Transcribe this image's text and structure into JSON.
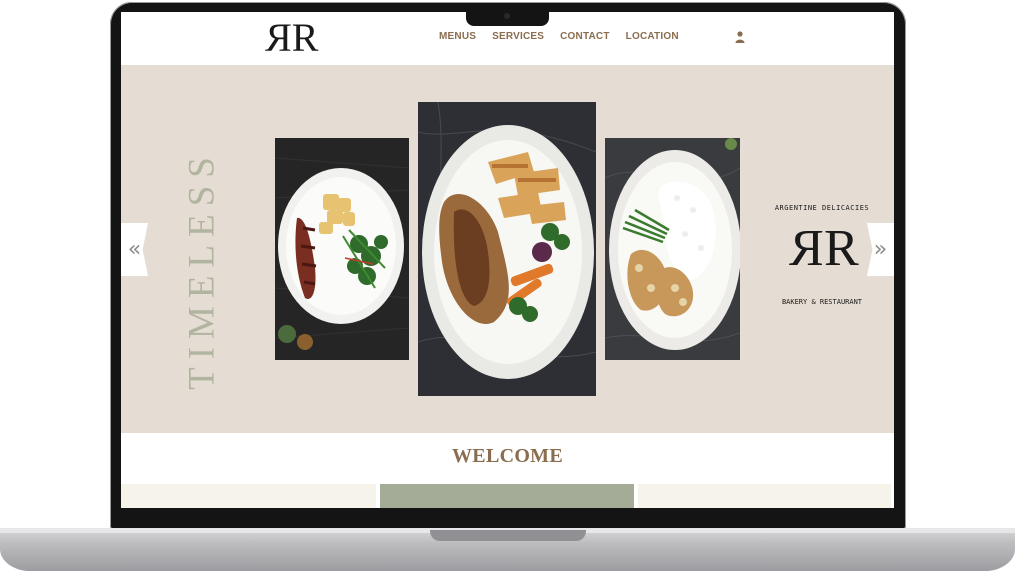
{
  "header": {
    "logo_text_mirror": "R",
    "logo_text": "R",
    "nav": [
      {
        "label": "MENUS"
      },
      {
        "label": "SERVICES"
      },
      {
        "label": "CONTACT"
      },
      {
        "label": "LOCATION"
      }
    ],
    "user_icon": "user-icon"
  },
  "hero": {
    "vertical_title": "TIMELESS",
    "arrow_left": "‹",
    "arrow_right": "›",
    "badge": {
      "top_text": "ARGENTINE DELICACIES",
      "logo_mirror": "R",
      "logo": "R",
      "bottom_text": "BAKERY & RESTAURANT"
    }
  },
  "welcome": {
    "heading": "WELCOME"
  },
  "colors": {
    "accent_brown": "#8a6d4e",
    "hero_bg": "#e5ddd3",
    "sage": "#a4ab97",
    "timeless_text": "#b1b49f"
  }
}
